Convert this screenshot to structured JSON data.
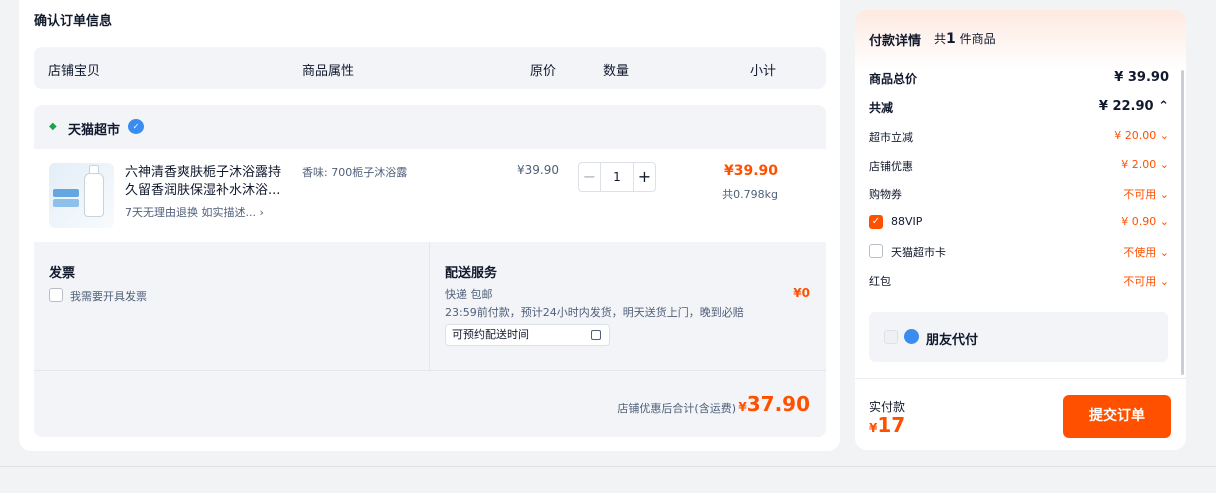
{
  "left": {
    "title": "确认订单信息",
    "columns": [
      "店铺宝贝",
      "商品属性",
      "原价",
      "数量",
      "小计"
    ],
    "shop": {
      "name": "天猫超市",
      "item": {
        "name": "六神清香爽肤栀子沐浴露持久留香润肤保湿补水沐浴...",
        "service": "7天无理由退换  如实描述...",
        "attr": "香味: 700栀子沐浴露",
        "price": "¥39.90",
        "qty": "1",
        "subtotal": "¥39.90",
        "weight": "共0.798kg"
      },
      "invoice": {
        "title": "发票",
        "option": "我需要开具发票"
      },
      "shipping": {
        "title": "配送服务",
        "method": "快递 包邮",
        "note": "23:59前付款，预计24小时内发货，明天送货上门，晚到必赔",
        "fee": "¥0",
        "schedule_placeholder": "可预约配送时间"
      },
      "total_label": "店铺优惠后合计(含运费)",
      "total_currency": "¥",
      "total_value": "37.90"
    }
  },
  "right": {
    "title": "付款详情",
    "count_prefix": "共",
    "count": "1",
    "count_suffix": "件商品",
    "rows": [
      {
        "k": "商品总价",
        "v": "¥ 39.90"
      },
      {
        "k": "共减",
        "v": "¥ 22.90 ⌃"
      },
      {
        "k": "超市立减",
        "v": "¥ 20.00 ⌄"
      },
      {
        "k": "店铺优惠",
        "v": "¥ 2.00 ⌄"
      },
      {
        "k": "购物券",
        "v": "不可用 ⌄"
      },
      {
        "k": "88VIP",
        "v": "¥ 0.90 ⌄"
      },
      {
        "k": "天猫超市卡",
        "v": "不使用 ⌄"
      },
      {
        "k": "红包",
        "v": "不可用 ⌄"
      }
    ],
    "friend_pay": "朋友代付",
    "pay_label": "实付款",
    "pay_currency": "¥",
    "pay_value": "17",
    "submit": "提交订单"
  },
  "colors": {
    "accent": "#ff5000",
    "bg": "#f2f3f5",
    "panel": "#f2f4f7"
  }
}
